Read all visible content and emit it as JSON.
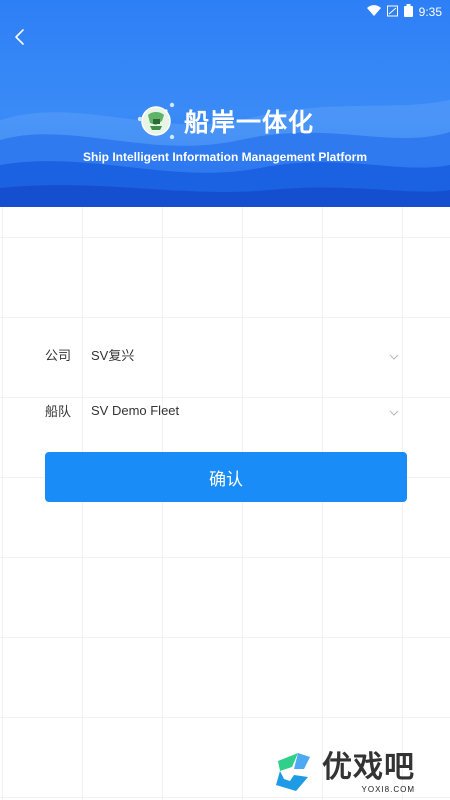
{
  "status_bar": {
    "time": "9:35"
  },
  "header": {
    "title": "船岸一体化",
    "subtitle": "Ship Intelligent Information Management Platform"
  },
  "form": {
    "company": {
      "label": "公司",
      "value": "SV复兴"
    },
    "fleet": {
      "label": "船队",
      "value": "SV Demo Fleet"
    },
    "confirm_label": "确认"
  },
  "watermark": {
    "main": "优戏吧",
    "sub": "YOXI8.COM"
  },
  "colors": {
    "banner": "#2e7ff6",
    "button": "#1a8cf7",
    "text": "#333333"
  },
  "icons": [
    "wifi-icon",
    "signal-icon",
    "battery-icon",
    "back-arrow-icon",
    "globe-logo-icon",
    "chevron-down-icon"
  ]
}
